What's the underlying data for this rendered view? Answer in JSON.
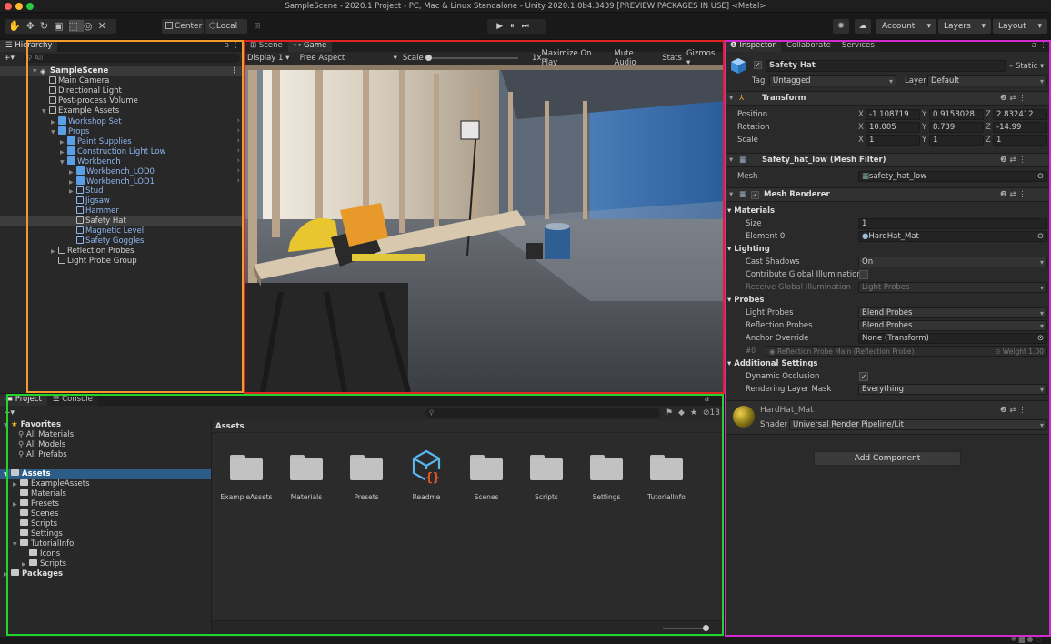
{
  "window": {
    "title": "SampleScene - 2020.1 Project - PC, Mac & Linux Standalone - Unity 2020.1.0b4.3439 [PREVIEW PACKAGES IN USE] <Metal>"
  },
  "toolbar": {
    "pivot_center": "Center",
    "pivot_local": "Local",
    "account": "Account",
    "layers": "Layers",
    "layout": "Layout"
  },
  "hierarchy": {
    "tab": "Hierarchy",
    "add": "+▾",
    "search_placeholder": "All",
    "items": [
      {
        "label": "SampleScene",
        "depth": 0,
        "type": "scene",
        "expanded": true
      },
      {
        "label": "Main Camera",
        "depth": 1,
        "type": "object"
      },
      {
        "label": "Directional Light",
        "depth": 1,
        "type": "object"
      },
      {
        "label": "Post-process Volume",
        "depth": 1,
        "type": "object"
      },
      {
        "label": "Example Assets",
        "depth": 1,
        "type": "object",
        "expanded": true
      },
      {
        "label": "Workshop Set",
        "depth": 2,
        "type": "prefab",
        "collapsed": true
      },
      {
        "label": "Props",
        "depth": 2,
        "type": "prefab",
        "expanded": true
      },
      {
        "label": "Paint Supplies",
        "depth": 3,
        "type": "prefab",
        "collapsed": true
      },
      {
        "label": "Construction Light Low",
        "depth": 3,
        "type": "prefab",
        "collapsed": true
      },
      {
        "label": "Workbench",
        "depth": 3,
        "type": "prefab",
        "expanded": true
      },
      {
        "label": "Workbench_LOD0",
        "depth": 4,
        "type": "prefab",
        "collapsed": true
      },
      {
        "label": "Workbench_LOD1",
        "depth": 4,
        "type": "prefab",
        "collapsed": true
      },
      {
        "label": "Stud",
        "depth": 4,
        "type": "object-blue",
        "collapsed": true
      },
      {
        "label": "Jigsaw",
        "depth": 4,
        "type": "object-blue"
      },
      {
        "label": "Hammer",
        "depth": 4,
        "type": "object-blue"
      },
      {
        "label": "Safety Hat",
        "depth": 4,
        "type": "object",
        "selected": true
      },
      {
        "label": "Magnetic Level",
        "depth": 4,
        "type": "object-blue"
      },
      {
        "label": "Safety Goggles",
        "depth": 4,
        "type": "object-blue"
      },
      {
        "label": "Reflection Probes",
        "depth": 2,
        "type": "object",
        "collapsed": true
      },
      {
        "label": "Light Probe Group",
        "depth": 2,
        "type": "object"
      }
    ]
  },
  "view": {
    "tabs": [
      "Scene",
      "Game"
    ],
    "display": "Display 1",
    "aspect": "Free Aspect",
    "scale_label": "Scale",
    "scale_value": "1x",
    "maximize": "Maximize On Play",
    "mute": "Mute Audio",
    "stats": "Stats",
    "gizmos": "Gizmos"
  },
  "inspector": {
    "tabs": [
      "Inspector",
      "Collaborate",
      "Services"
    ],
    "object_name": "Safety Hat",
    "static": "Static",
    "tag_label": "Tag",
    "tag_value": "Untagged",
    "layer_label": "Layer",
    "layer_value": "Default",
    "transform": {
      "title": "Transform",
      "rows": [
        {
          "label": "Position",
          "x": "-1.108719",
          "y": "0.9158028",
          "z": "2.832412"
        },
        {
          "label": "Rotation",
          "x": "10.005",
          "y": "8.739",
          "z": "-14.99"
        },
        {
          "label": "Scale",
          "x": "1",
          "y": "1",
          "z": "1"
        }
      ]
    },
    "mesh_filter": {
      "title": "Safety_hat_low (Mesh Filter)",
      "mesh_label": "Mesh",
      "mesh_value": "safety_hat_low"
    },
    "mesh_renderer": {
      "title": "Mesh Renderer",
      "materials": "Materials",
      "size_label": "Size",
      "size_value": "1",
      "element0_label": "Element 0",
      "element0_value": "HardHat_Mat",
      "lighting": "Lighting",
      "cast_shadows_label": "Cast Shadows",
      "cast_shadows_value": "On",
      "contrib_gi_label": "Contribute Global Illumination",
      "receive_gi_label": "Receive Global Illumination",
      "receive_gi_value": "Light Probes",
      "probes": "Probes",
      "light_probes_label": "Light Probes",
      "light_probes_value": "Blend Probes",
      "reflection_probes_label": "Reflection Probes",
      "reflection_probes_value": "Blend Probes",
      "anchor_label": "Anchor Override",
      "anchor_value": "None (Transform)",
      "probe_index": "#0",
      "probe_name": "Reflection Probe Main (Reflection Probe)",
      "probe_weight": "Weight 1.00",
      "additional": "Additional Settings",
      "dynamic_occlusion_label": "Dynamic Occlusion",
      "rendering_layer_label": "Rendering Layer Mask",
      "rendering_layer_value": "Everything"
    },
    "material": {
      "name": "HardHat_Mat",
      "shader_label": "Shader",
      "shader_value": "Universal Render Pipeline/Lit"
    },
    "add_component": "Add Component"
  },
  "project": {
    "tabs": [
      "Project",
      "Console"
    ],
    "add": "+▾",
    "hidden_count": "13",
    "favorites_label": "Favorites",
    "favorites": [
      "All Materials",
      "All Models",
      "All Prefabs"
    ],
    "assets_label": "Assets",
    "asset_tree": [
      {
        "label": "ExampleAssets",
        "depth": 1,
        "collapsed": true
      },
      {
        "label": "Materials",
        "depth": 1
      },
      {
        "label": "Presets",
        "depth": 1,
        "collapsed": true
      },
      {
        "label": "Scenes",
        "depth": 1
      },
      {
        "label": "Scripts",
        "depth": 1
      },
      {
        "label": "Settings",
        "depth": 1
      },
      {
        "label": "TutorialInfo",
        "depth": 1,
        "expanded": true
      },
      {
        "label": "Icons",
        "depth": 2
      },
      {
        "label": "Scripts",
        "depth": 2,
        "collapsed": true
      }
    ],
    "packages_label": "Packages",
    "breadcrumb": "Assets",
    "grid_items": [
      "ExampleAssets",
      "Materials",
      "Presets",
      "Readme",
      "Scenes",
      "Scripts",
      "Settings",
      "TutorialInfo"
    ]
  },
  "colors": {
    "hierarchy_outline": "#f29a2e",
    "view_outline": "#e02424",
    "project_outline": "#21d32b",
    "inspector_outline": "#d12ad1",
    "selection": "#2c5d87",
    "prefab_blue": "#8fb5ef"
  }
}
